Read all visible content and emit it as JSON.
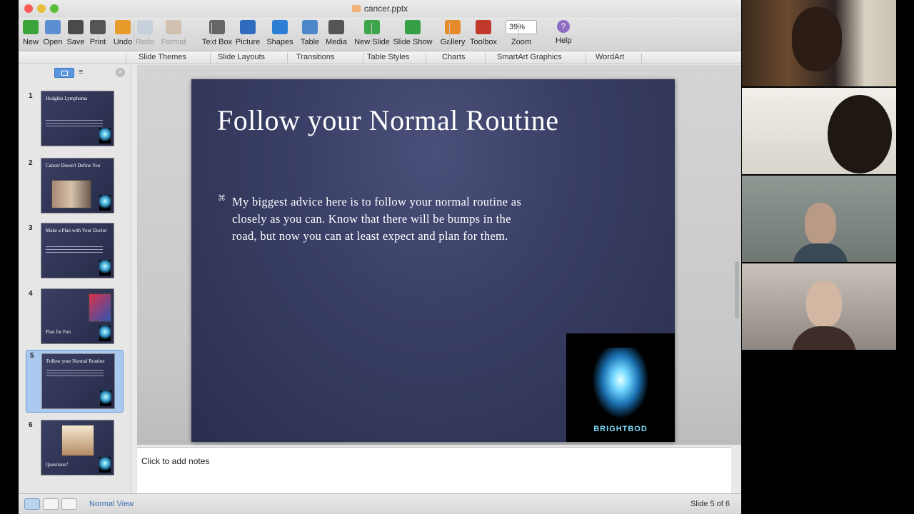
{
  "window": {
    "title": "cancer.pptx"
  },
  "toolbar": [
    {
      "name": "new",
      "label": "New",
      "color": "#3aa33a",
      "disabled": false
    },
    {
      "name": "open",
      "label": "Open",
      "color": "#5c8fd1",
      "disabled": false
    },
    {
      "name": "save",
      "label": "Save",
      "color": "#4a4a4a",
      "disabled": false
    },
    {
      "name": "print",
      "label": "Print",
      "color": "#555555",
      "disabled": false
    },
    {
      "name": "undo",
      "label": "Undo",
      "color": "#e89a2b",
      "disabled": false
    },
    {
      "name": "redo",
      "label": "Redo",
      "color": "#9bb6d8",
      "disabled": true
    },
    {
      "name": "format",
      "label": "Format",
      "color": "#b98a5a",
      "disabled": true
    },
    {
      "name": "text-box",
      "label": "Text Box",
      "color": "#666666",
      "disabled": false
    },
    {
      "name": "picture",
      "label": "Picture",
      "color": "#2f6cc0",
      "disabled": false
    },
    {
      "name": "shapes",
      "label": "Shapes",
      "color": "#2b7fd4",
      "disabled": false
    },
    {
      "name": "table",
      "label": "Table",
      "color": "#4d86c9",
      "disabled": false
    },
    {
      "name": "media",
      "label": "Media",
      "color": "#555555",
      "disabled": false
    },
    {
      "name": "new-slide",
      "label": "New Slide",
      "color": "#3da64a",
      "disabled": false
    },
    {
      "name": "slide-show",
      "label": "Slide Show",
      "color": "#35a045",
      "disabled": false
    },
    {
      "name": "gallery",
      "label": "Gallery",
      "color": "#e58b2c",
      "disabled": false
    },
    {
      "name": "toolbox",
      "label": "Toolbox",
      "color": "#c0392b",
      "disabled": false
    },
    {
      "name": "zoom",
      "label": "Zoom",
      "color": "#ffffff",
      "disabled": false
    },
    {
      "name": "help",
      "label": "Help",
      "color": "#8e6cc4",
      "disabled": false
    }
  ],
  "zoom": {
    "value": "39%"
  },
  "ribbon": [
    "Slide Themes",
    "Slide Layouts",
    "Transitions",
    "Table Styles",
    "Charts",
    "SmartArt Graphics",
    "WordArt"
  ],
  "slides": [
    {
      "num": "1",
      "title": "Hodgkin Lymphoma"
    },
    {
      "num": "2",
      "title": "Cancer Doesn't Define You"
    },
    {
      "num": "3",
      "title": "Make a Plan with Your Doctor"
    },
    {
      "num": "4",
      "title": "Plan for Fun"
    },
    {
      "num": "5",
      "title": "Follow your Normal Routine"
    },
    {
      "num": "6",
      "title": "Questions?"
    }
  ],
  "selected_slide": 5,
  "current_slide": {
    "title": "Follow your Normal Routine",
    "body": "My biggest advice here is to follow your normal routine as closely as you can.  Know that there will be bumps in the road, but now you can at least expect and plan for them.",
    "logo_text": "BRIGHTBOD"
  },
  "notes": {
    "placeholder": "Click to add notes"
  },
  "status": {
    "view": "Normal View",
    "counter": "Slide 5 of 6"
  }
}
